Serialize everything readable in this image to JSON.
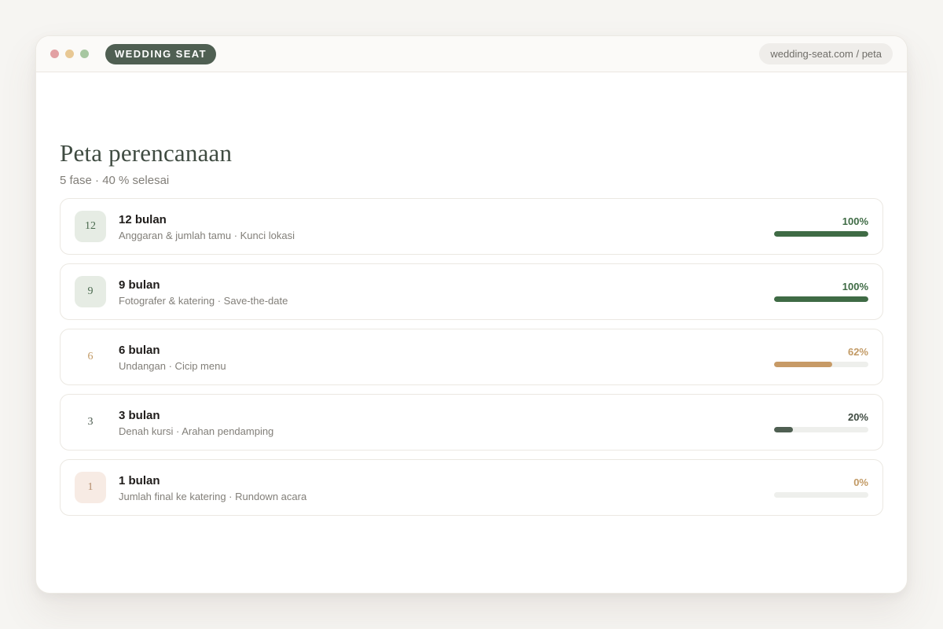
{
  "window": {
    "brand": "WEDDING SEAT",
    "url": "wedding-seat.com / peta"
  },
  "page": {
    "title": "Peta perencanaan",
    "subtitle": "5 fase · 40 % selesai"
  },
  "colors": {
    "done": "#3f6b45",
    "active": "#c79a66",
    "in_progress": "#4f5f52",
    "brand": "#4f5f52"
  },
  "phases": [
    {
      "badge": "12",
      "title": "12 bulan",
      "desc": "Anggaran & jumlah tamu · Kunci lokasi",
      "percent_label": "100%",
      "progress": 100,
      "state": "done"
    },
    {
      "badge": "9",
      "title": "9 bulan",
      "desc": "Fotografer & katering · Save-the-date",
      "percent_label": "100%",
      "progress": 100,
      "state": "done"
    },
    {
      "badge": "6",
      "title": "6 bulan",
      "desc": "Undangan · Cicip menu",
      "percent_label": "62%",
      "progress": 62,
      "state": "active"
    },
    {
      "badge": "3",
      "title": "3 bulan",
      "desc": "Denah kursi · Arahan pendamping",
      "percent_label": "20%",
      "progress": 20,
      "state": "plain"
    },
    {
      "badge": "1",
      "title": "1 bulan",
      "desc": "Jumlah final ke katering · Rundown acara",
      "percent_label": "0%",
      "progress": 0,
      "state": "pending"
    }
  ]
}
